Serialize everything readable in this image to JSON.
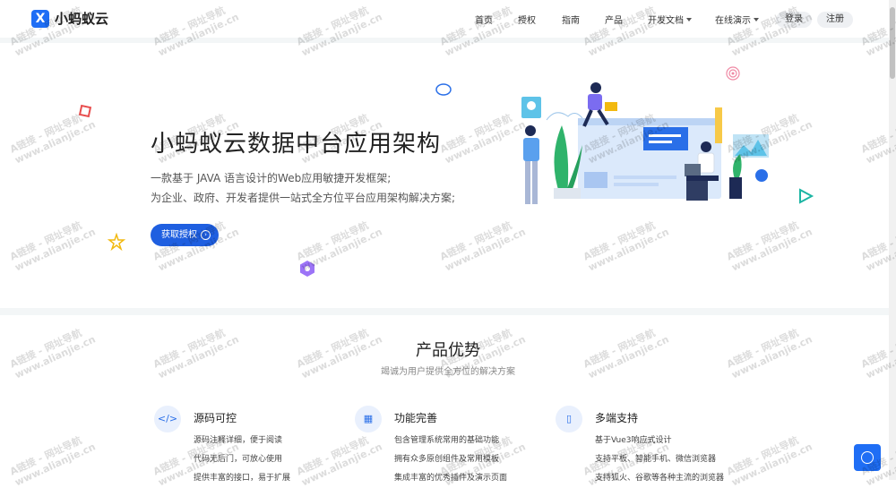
{
  "brand": {
    "name": "小蚂蚁云",
    "logo_glyph": "X",
    "color": "#1f6ef5"
  },
  "nav": {
    "items": [
      "首页",
      "授权",
      "指南",
      "产品",
      "开发文档",
      "在线演示"
    ],
    "login": "登录",
    "register": "注册"
  },
  "hero": {
    "title": "小蚂蚁云数据中台应用架构",
    "desc_line1": "一款基于 JAVA 语言设计的Web应用敏捷开发框架;",
    "desc_line2": "为企业、政府、开发者提供一站式全方位平台应用架构解决方案;",
    "cta": "获取授权"
  },
  "section": {
    "title": "产品优势",
    "subtitle": "竭诚为用户提供全方位的解决方案"
  },
  "features": [
    {
      "icon": "code-icon",
      "glyph": "</>",
      "title": "源码可控",
      "lines": [
        "源码注释详细，便于阅读",
        "代码无后门，可放心使用",
        "提供丰富的接口，易于扩展"
      ]
    },
    {
      "icon": "modules-icon",
      "glyph": "▦",
      "title": "功能完善",
      "lines": [
        "包含管理系统常用的基础功能",
        "拥有众多原创组件及常用模板",
        "集成丰富的优秀插件及演示页面"
      ]
    },
    {
      "icon": "mobile-icon",
      "glyph": "▯",
      "title": "多端支持",
      "lines": [
        "基于Vue3响应式设计",
        "支持平板、智能手机、微信浏览器",
        "支持狐火、谷歌等各种主流的浏览器"
      ]
    }
  ],
  "watermark": {
    "line1": "A链接 - 网址导航",
    "line2": "www.alianjie.cn"
  }
}
